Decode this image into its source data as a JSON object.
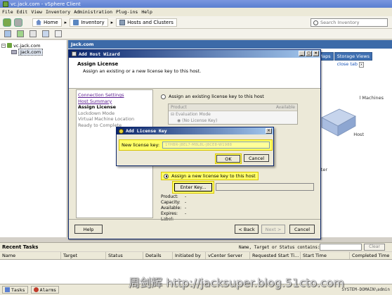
{
  "window": {
    "title": "vc.jack.com - vSphere Client"
  },
  "menu": [
    "File",
    "Edit",
    "View",
    "Inventory",
    "Administration",
    "Plug-ins",
    "Help"
  ],
  "breadcrumb": {
    "home": "Home",
    "inventory": "Inventory",
    "hosts": "Hosts and Clusters"
  },
  "search": {
    "placeholder": "Search Inventory"
  },
  "tree": {
    "root": "vc.jack.com",
    "datacenter": "Jack.com"
  },
  "background": {
    "header": "Jack.com",
    "tabs": [
      "Maps",
      "Storage Views"
    ],
    "close_tab": "close tab",
    "labels": {
      "machines": "l Machines",
      "host": "Host",
      "center": "ter"
    }
  },
  "wizard": {
    "title": "Add Host Wizard",
    "header_title": "Assign License",
    "header_subtitle": "Assign an existing or a new license key to this host.",
    "steps": [
      {
        "label": "Connection Settings",
        "state": "done"
      },
      {
        "label": "Host Summary",
        "state": "done"
      },
      {
        "label": "Assign License",
        "state": "current"
      },
      {
        "label": "Lockdown Mode",
        "state": "future"
      },
      {
        "label": "Virtual Machine Location",
        "state": "future"
      },
      {
        "label": "Ready to Complete",
        "state": "future"
      }
    ],
    "existing_option": "Assign an existing license key to this host",
    "table": {
      "col_product": "Product",
      "col_available": "Available",
      "group": "Evaluation Mode",
      "item": "(No License Key)"
    },
    "new_option": "Assign a new license key to this host",
    "enter_key_button": "Enter Key...",
    "details": [
      {
        "label": "Product:",
        "value": "-"
      },
      {
        "label": "Capacity:",
        "value": "-"
      },
      {
        "label": "Available:",
        "value": "-"
      },
      {
        "label": "Expires:",
        "value": "-"
      },
      {
        "label": "Label:",
        "value": "-"
      }
    ],
    "buttons": {
      "help": "Help",
      "back": "< Back",
      "next": "Next >",
      "cancel": "Cancel"
    }
  },
  "license_dialog": {
    "title": "Add License Key",
    "label": "New license key:",
    "value": "1YHBR-J8EL7-M8L8L-J8CE8-W1988",
    "ok": "OK",
    "cancel": "Cancel"
  },
  "recent_tasks": {
    "title": "Recent Tasks",
    "filter_label": "Name, Target or Status contains:",
    "clear": "Clear",
    "columns": [
      "Name",
      "Target",
      "Status",
      "Details",
      "Initiated by",
      "vCenter Server",
      "Requested Start Ti...",
      "Start Time",
      "Completed Time"
    ]
  },
  "statusbar": {
    "tasks": "Tasks",
    "alarms": "Alarms",
    "user": "SYSTEM-DOMAIN\\admin"
  },
  "watermark": "周剑辉 http://jacksuper.blog.51cto.com"
}
